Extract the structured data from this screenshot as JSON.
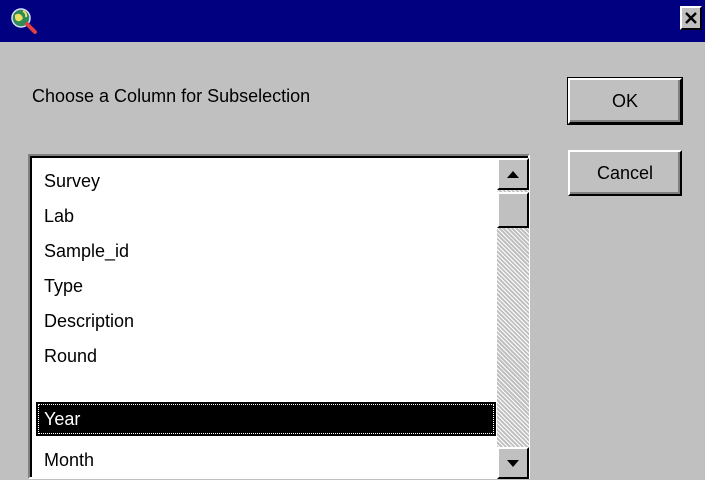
{
  "window": {
    "title": "",
    "close_glyph": "✕"
  },
  "dialog": {
    "prompt": "Choose a Column for Subselection",
    "ok_label": "OK",
    "cancel_label": "Cancel"
  },
  "listbox": {
    "items": [
      "Survey",
      "Lab",
      "Sample_id",
      "Type",
      "Description",
      "Round",
      "Year",
      "Month"
    ],
    "selected": "Year"
  },
  "icons": {
    "app": "globe-magnifier-icon",
    "close": "close-icon",
    "scroll_up": "arrow-up-icon",
    "scroll_down": "arrow-down-icon"
  },
  "colors": {
    "titlebar": "#000080",
    "dialog_bg": "#c0c0c0",
    "selection_bg": "#000000",
    "selection_fg": "#ffffff"
  }
}
